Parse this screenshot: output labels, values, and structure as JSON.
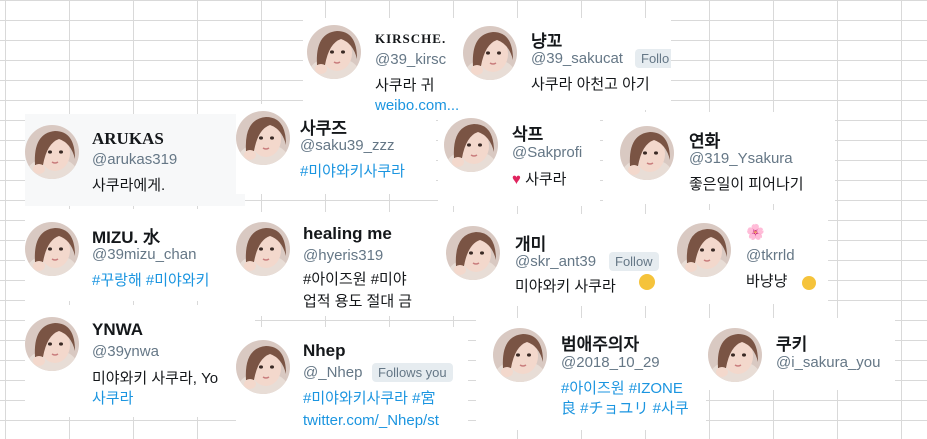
{
  "cards": [
    {
      "name": "KIRSCHE.",
      "handle": "@39_kirsc",
      "bio": "사쿠라 귀",
      "link": "weibo.com..."
    },
    {
      "name": "냥꼬",
      "handle": "@39_sakucat",
      "badge": "Follo",
      "bio": "사쿠라 아천고 아기"
    },
    {
      "name": "ARUKAS",
      "handle": "@arukas319",
      "bio": "사쿠라에게."
    },
    {
      "name": "사쿠즈",
      "handle": "@saku39_zzz",
      "bio": "#미야와키사쿠라"
    },
    {
      "name": "삭프",
      "handle": "@Sakprofi",
      "bio": "사쿠라",
      "emoji": "♥"
    },
    {
      "name": "연화",
      "handle": "@319_Ysakura",
      "bio": "좋은일이 피어나기"
    },
    {
      "name": "MIZU. 水",
      "handle": "@39mizu_chan",
      "bio": "#꾸랑해 #미야와키"
    },
    {
      "name": "healing me",
      "handle": "@hyeris319",
      "bio": "#아이즈원 #미야",
      "bio2": "업적 용도 절대 금"
    },
    {
      "name": "개미",
      "handle": "@skr_ant39",
      "badge": "Follow",
      "bio": "미야와키 사쿠라"
    },
    {
      "name": "🌸",
      "handle": "@tkrrld",
      "bio": "바냥냥"
    },
    {
      "name": "YNWA",
      "handle": "@39ynwa",
      "bio": "미야와키 사쿠라, Yo",
      "bio2": "사쿠라"
    },
    {
      "name": "Nhep",
      "handle": "@_Nhep",
      "badge": "Follows you",
      "bio": "#미야와키사쿠라 #宮",
      "bio2": "twitter.com/_Nhep/st"
    },
    {
      "name": "범애주의자",
      "handle": "@2018_10_29",
      "bio": "#아이즈원 #IZONE",
      "bio2": "良 #チョユリ #사쿠"
    },
    {
      "name": "쿠키",
      "handle": "@i_sakura_you"
    }
  ],
  "colors": {
    "link": "#1b95e0",
    "handle": "#657786",
    "text": "#14171a",
    "grid": "#d9d9d9"
  }
}
